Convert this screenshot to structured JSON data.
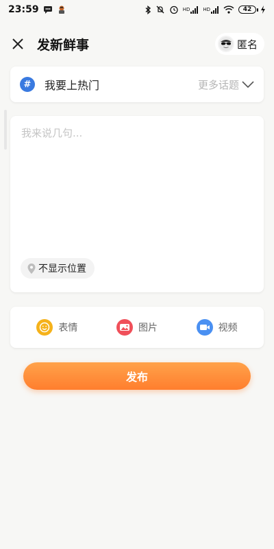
{
  "status_bar": {
    "time": "23:59",
    "battery": "42",
    "signal_tag": "HD"
  },
  "header": {
    "title": "发新鲜事",
    "anonymous_label": "匿名"
  },
  "topic": {
    "label": "我要上热门",
    "badge": "#",
    "more_label": "更多话题"
  },
  "post": {
    "placeholder": "我来说几句...",
    "location_label": "不显示位置"
  },
  "media": {
    "items": [
      {
        "label": "表情",
        "color": "#f5b21b",
        "icon": "emoji-icon"
      },
      {
        "label": "图片",
        "color": "#f0505a",
        "icon": "image-icon"
      },
      {
        "label": "视频",
        "color": "#4a90f2",
        "icon": "video-icon"
      }
    ]
  },
  "actions": {
    "publish_label": "发布"
  },
  "colors": {
    "accent": "#ff8c38",
    "topic_blue": "#3a7ae0"
  }
}
